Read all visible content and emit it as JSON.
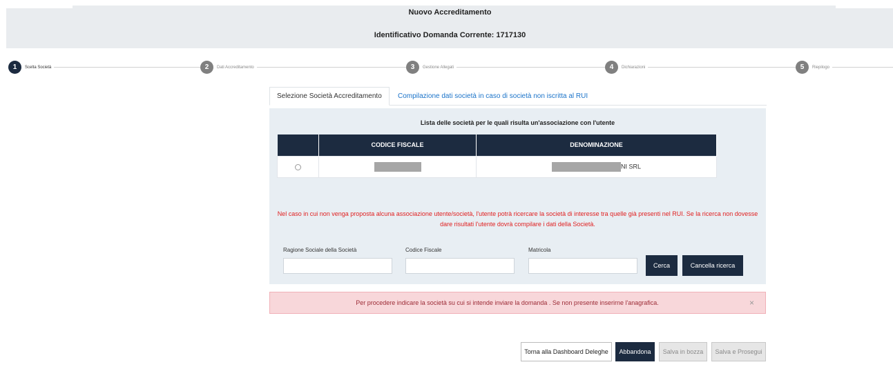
{
  "header": {
    "title": "Nuovo Accreditamento",
    "id_label": "Identificativo Domanda Corrente: 1717130"
  },
  "stepper": {
    "steps": [
      {
        "num": "1",
        "label": "Scelta Società",
        "active": true
      },
      {
        "num": "2",
        "label": "Dati Accreditamento",
        "active": false
      },
      {
        "num": "3",
        "label": "Gestione Allegati",
        "active": false
      },
      {
        "num": "4",
        "label": "Dichiarazioni",
        "active": false
      },
      {
        "num": "5",
        "label": "Riepilogo",
        "active": false
      }
    ]
  },
  "tabs": {
    "selection": "Selezione Società Accreditamento",
    "compile": "Compilazione dati società in caso di società non iscritta al RUI"
  },
  "panel": {
    "title": "Lista delle società per le quali risulta un'associazione con l'utente",
    "table": {
      "columns": [
        "CODICE FISCALE",
        "DENOMINAZIONE"
      ],
      "rows": [
        {
          "codice_fiscale": "",
          "denominazione_suffix": "NI SRL"
        }
      ]
    },
    "warning": "Nel caso in cui non venga proposta alcuna associazione utente/società, l'utente potrà ricercare la società di interesse tra quelle già presenti nel RUI. Se la ricerca non dovesse dare risultati l'utente dovrà compilare i dati della Società.",
    "search": {
      "ragione_label": "Ragione Sociale della Società",
      "ragione_value": "",
      "codice_label": "Codice Fiscale",
      "codice_value": "",
      "matricola_label": "Matricola",
      "matricola_value": "",
      "cerca": "Cerca",
      "cancella": "Cancella ricerca"
    }
  },
  "alert": {
    "text": "Per procedere indicare la società su cui si intende inviare la domanda . Se non presente inserirne l'anagrafica.",
    "close": "×"
  },
  "footer": {
    "torna": "Torna alla Dashboard Deleghe",
    "abbandona": "Abbandona",
    "salva_bozza": "Salva in bozza",
    "salva_prosegui": "Salva e Prosegui"
  },
  "colors": {
    "primary_dark": "#1c2b40",
    "link": "#1a73c9",
    "warning_text": "#e02020",
    "alert_bg": "#f8d7da"
  }
}
